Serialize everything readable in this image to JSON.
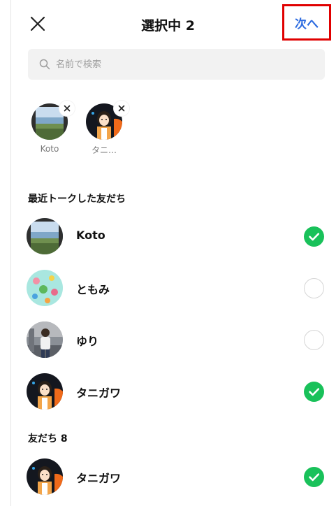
{
  "header": {
    "title": "選択中 2",
    "next_label": "次へ"
  },
  "search": {
    "placeholder": "名前で検索"
  },
  "selected": [
    {
      "name": "Koto"
    },
    {
      "name": "タニ…"
    }
  ],
  "sections": {
    "recent_title": "最近トークした友だち",
    "friends_title": "友だち 8"
  },
  "recent": [
    {
      "name": "Koto",
      "selected": true
    },
    {
      "name": "ともみ",
      "selected": false
    },
    {
      "name": "ゆり",
      "selected": false
    },
    {
      "name": "タニガワ",
      "selected": true
    }
  ],
  "friends": [
    {
      "name": "タニガワ",
      "selected": true
    }
  ],
  "colors": {
    "accent_blue": "#2f6de0",
    "check_green": "#19c15a",
    "highlight_red": "#e00000"
  }
}
